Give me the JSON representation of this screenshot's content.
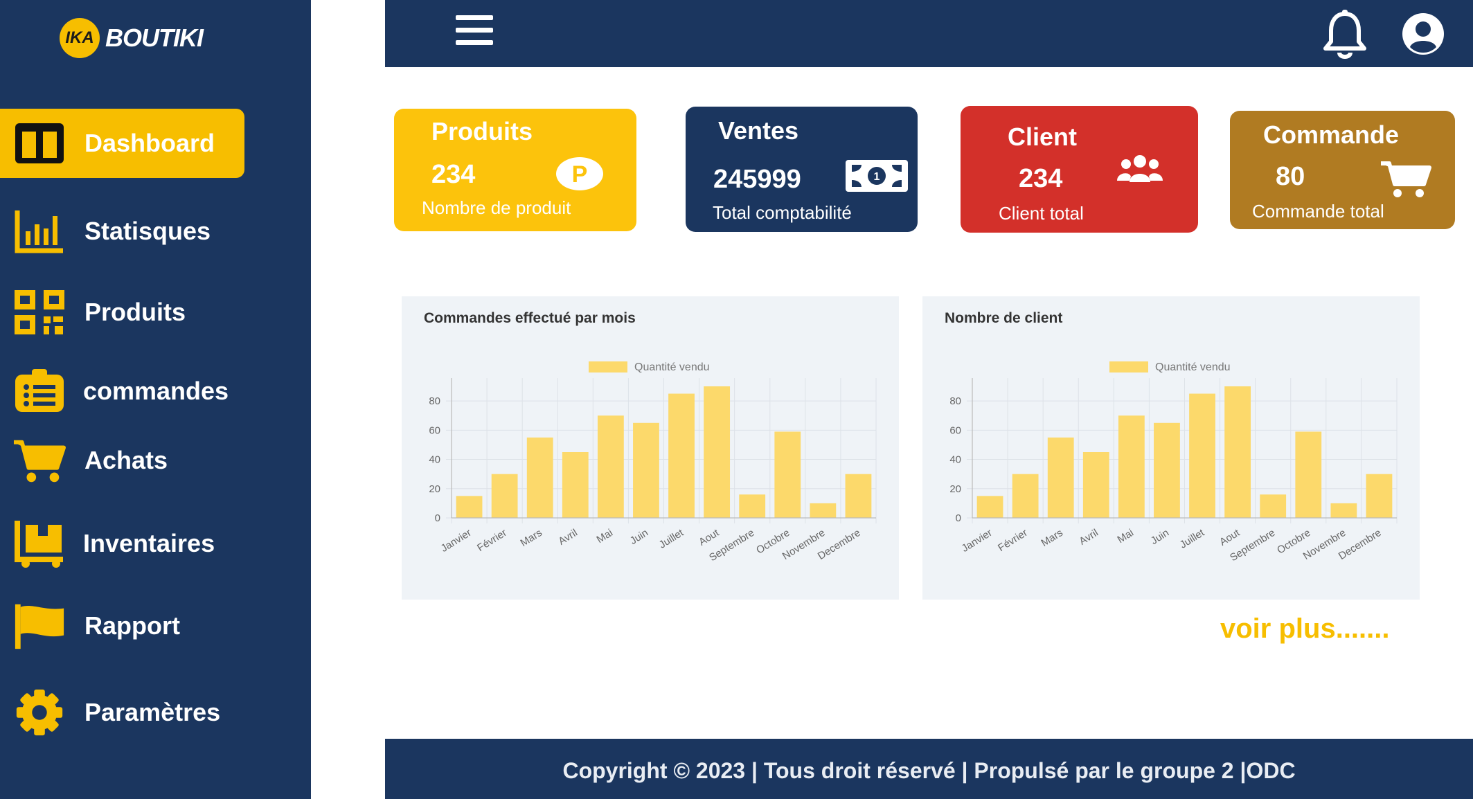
{
  "brand": {
    "logo_mark": "IKA",
    "logo_text": "BOUTIKI"
  },
  "sidebar": {
    "items": [
      {
        "label": "Dashboard",
        "icon": "dashboard-icon",
        "active": true
      },
      {
        "label": "Statisques",
        "icon": "bar-chart-icon"
      },
      {
        "label": "Produits",
        "icon": "qr-code-icon"
      },
      {
        "label": "commandes",
        "icon": "clipboard-list-icon"
      },
      {
        "label": "Achats",
        "icon": "shopping-cart-icon"
      },
      {
        "label": "Inventaires",
        "icon": "inventory-cart-icon"
      },
      {
        "label": "Rapport",
        "icon": "flag-icon"
      },
      {
        "label": "Paramètres",
        "icon": "gear-icon"
      }
    ]
  },
  "header": {
    "menu_icon": "hamburger-icon",
    "notification_icon": "bell-icon",
    "profile_icon": "user-avatar-icon"
  },
  "cards": [
    {
      "title": "Produits",
      "value": "234",
      "subtitle": "Nombre de produit",
      "color": "#fcc30c",
      "icon": "p-coin-icon"
    },
    {
      "title": "Ventes",
      "value": "245999",
      "subtitle": "Total comptabilité",
      "color": "#1b365f",
      "icon": "banknote-icon"
    },
    {
      "title": "Client",
      "value": "234",
      "subtitle": "Client total",
      "color": "#d3302a",
      "icon": "users-icon"
    },
    {
      "title": "Commande",
      "value": "80",
      "subtitle": "Commande total",
      "color": "#b07b22",
      "icon": "shopping-cart-icon"
    }
  ],
  "chart_data": [
    {
      "type": "bar",
      "title": "Commandes effectué par mois",
      "categories": [
        "Janvier",
        "Février",
        "Mars",
        "Avril",
        "Mai",
        "Juin",
        "Juillet",
        "Aout",
        "Septembre",
        "Octobre",
        "Novembre",
        "Decembre"
      ],
      "series": [
        {
          "name": "Quantité vendu",
          "values": [
            15,
            30,
            55,
            45,
            70,
            65,
            85,
            90,
            16,
            59,
            10,
            30
          ]
        }
      ],
      "yticks": [
        "0",
        "20",
        "40",
        "60",
        "80"
      ],
      "ylim": [
        0,
        90
      ],
      "grid": true,
      "legend": "top",
      "bar_color": "#fcd96b"
    },
    {
      "type": "bar",
      "title": "Nombre de client",
      "categories": [
        "Janvier",
        "Février",
        "Mars",
        "Avril",
        "Mai",
        "Juin",
        "Juillet",
        "Aout",
        "Septembre",
        "Octobre",
        "Novembre",
        "Decembre"
      ],
      "series": [
        {
          "name": "Quantité vendu",
          "values": [
            15,
            30,
            55,
            45,
            70,
            65,
            85,
            90,
            16,
            59,
            10,
            30
          ]
        }
      ],
      "yticks": [
        "0",
        "20",
        "40",
        "60",
        "80"
      ],
      "ylim": [
        0,
        90
      ],
      "grid": true,
      "legend": "top",
      "bar_color": "#fcd96b"
    }
  ],
  "more_link": "voir plus.......",
  "footer": {
    "text": "Copyright © 2023 | Tous droit réservé | Propulsé par le groupe 2 |ODC"
  },
  "colors": {
    "navy": "#1b365f",
    "accent": "#f7be00"
  }
}
